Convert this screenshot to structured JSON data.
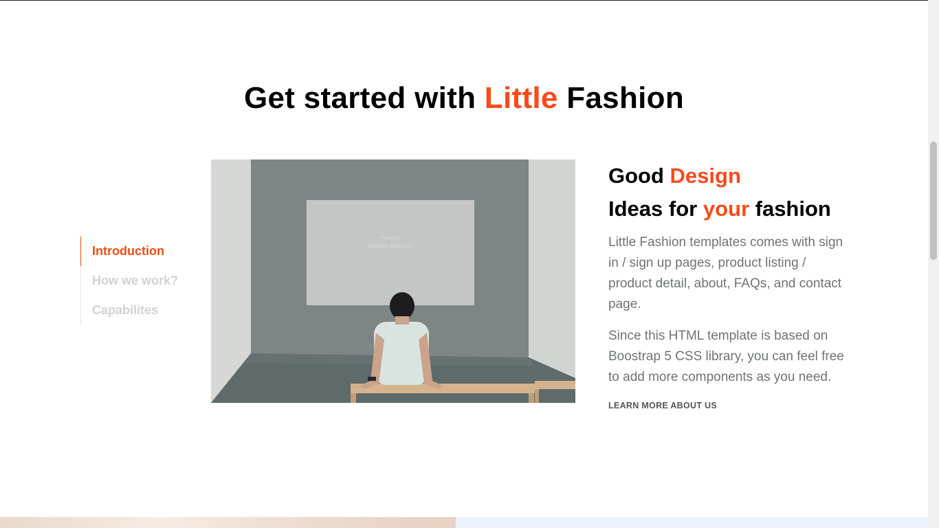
{
  "section": {
    "title_part1": "Get started with ",
    "title_accent": "Little",
    "title_part2": " Fashion"
  },
  "side_nav": {
    "items": [
      {
        "label": "Introduction",
        "active": true
      },
      {
        "label": "How we work?",
        "active": false
      },
      {
        "label": "Capabilites",
        "active": false
      }
    ]
  },
  "photo": {
    "screen_text_1": "Presents",
    "screen_text_2": "Apollon Pictures"
  },
  "content": {
    "heading1_part1": "Good ",
    "heading1_accent": "Design",
    "heading2_part1": "Ideas for ",
    "heading2_accent": "your",
    "heading2_part2": " fashion",
    "paragraph1": "Little Fashion templates comes with sign in / sign up pages, product listing / product detail, about, FAQs, and contact page.",
    "paragraph2": "Since this HTML template is based on Boostrap 5 CSS library, you can feel free to add more components as you need.",
    "link_label": "LEARN MORE ABOUT US"
  },
  "colors": {
    "accent": "#f94a1a",
    "text_muted": "#717275",
    "nav_inactive": "#d2d2d2"
  }
}
